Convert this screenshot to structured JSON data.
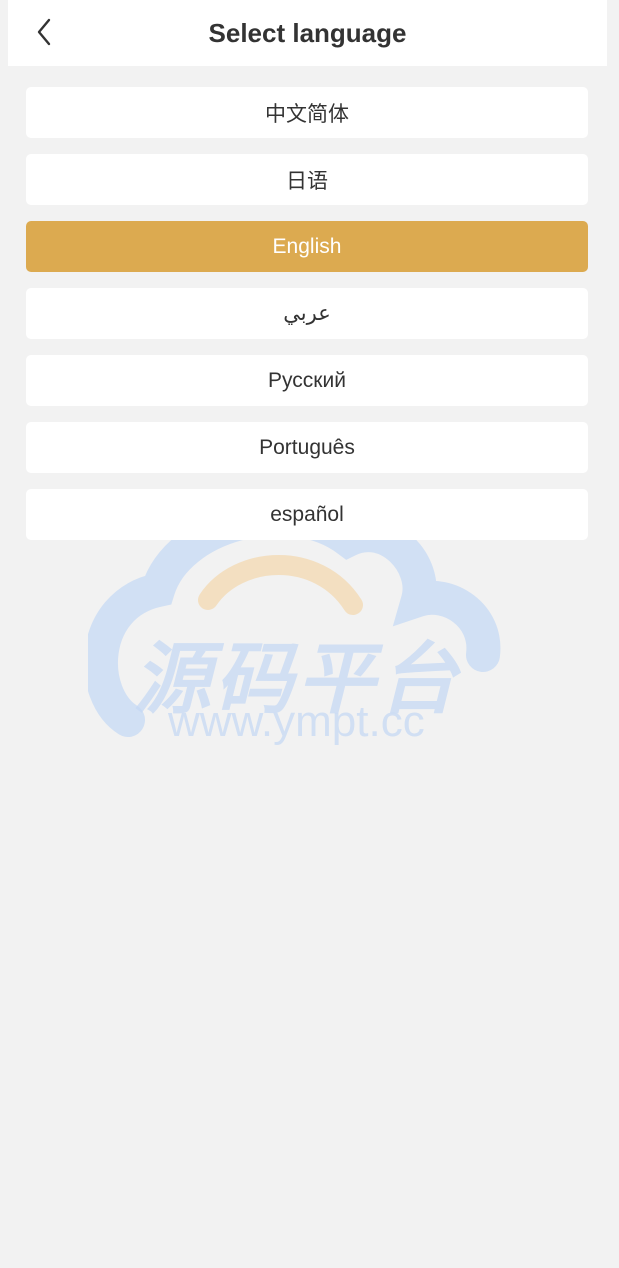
{
  "header": {
    "title": "Select language",
    "back_icon": "chevron-left-icon"
  },
  "languages": [
    {
      "label": "中文简体",
      "selected": false
    },
    {
      "label": "日语",
      "selected": false
    },
    {
      "label": "English",
      "selected": true
    },
    {
      "label": "عربي",
      "selected": false
    },
    {
      "label": "Русский",
      "selected": false
    },
    {
      "label": "Português",
      "selected": false
    },
    {
      "label": "español",
      "selected": false
    }
  ],
  "watermark": {
    "brand": "源码平台",
    "url": "www.ympt.cc"
  },
  "colors": {
    "accent": "#dcaa50",
    "background": "#f2f2f2",
    "card": "#ffffff",
    "text": "#333333",
    "watermark_blue": "#c6d9f4",
    "watermark_orange": "#f3dcb8"
  }
}
